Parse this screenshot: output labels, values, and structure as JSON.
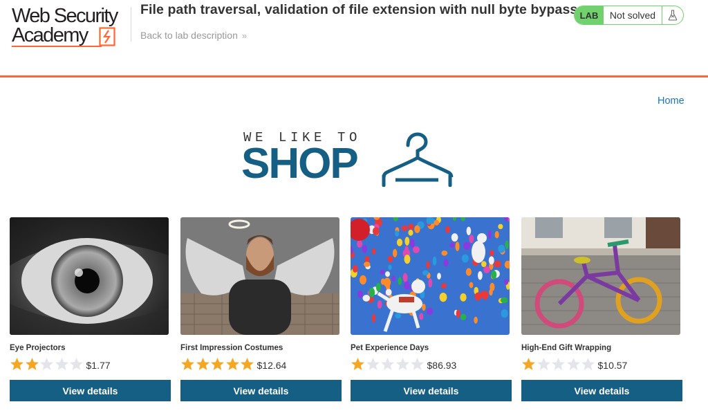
{
  "header": {
    "logo_line1": "Web Security",
    "logo_line2": "Academy",
    "lab_title": "File path traversal, validation of file extension with null byte bypass",
    "back_link": "Back to lab description",
    "lab_badge": "LAB",
    "status": "Not solved",
    "accent_color": "#ff6633",
    "status_color": "#70d16d"
  },
  "nav": {
    "home": "Home"
  },
  "banner": {
    "tagline": "WE LIKE TO",
    "title": "SHOP",
    "icon": "hanger-icon",
    "color": "#145f83"
  },
  "products": [
    {
      "name": "Eye Projectors",
      "rating": 2,
      "max_rating": 5,
      "price": "$1.77",
      "button": "View details",
      "image": "eye-closeup"
    },
    {
      "name": "First Impression Costumes",
      "rating": 5,
      "max_rating": 5,
      "price": "$12.64",
      "button": "View details",
      "image": "man-with-angel-wings"
    },
    {
      "name": "Pet Experience Days",
      "rating": 1,
      "max_rating": 5,
      "price": "$86.93",
      "button": "View details",
      "image": "dogs-with-balloons"
    },
    {
      "name": "High-End Gift Wrapping",
      "rating": 1,
      "max_rating": 5,
      "price": "$10.57",
      "button": "View details",
      "image": "knitted-bicycle"
    }
  ]
}
